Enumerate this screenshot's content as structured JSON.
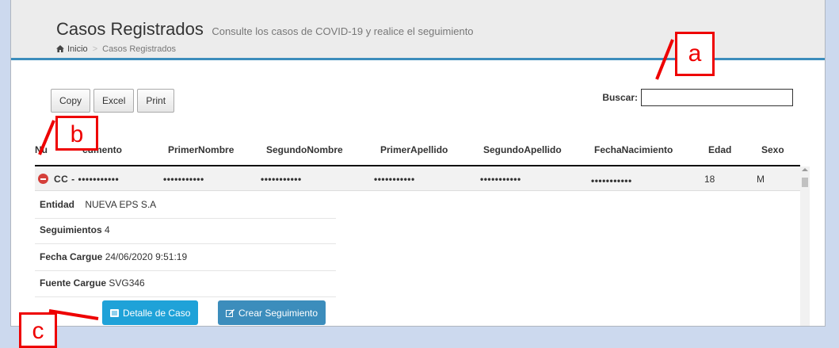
{
  "header": {
    "title": "Casos Registrados",
    "subtitle": "Consulte los casos de COVID-19 y realice el seguimiento",
    "breadcrumb": {
      "home": "Inicio",
      "current": "Casos Registrados"
    }
  },
  "toolbar": {
    "copy_label": "Copy",
    "excel_label": "Excel",
    "print_label": "Print"
  },
  "search": {
    "label": "Buscar:",
    "value": ""
  },
  "table": {
    "columns": [
      "Nu",
      "cumento",
      "PrimerNombre",
      "SegundoNombre",
      "PrimerApellido",
      "SegundoApellido",
      "FechaNacimiento",
      "Edad",
      "Sexo"
    ],
    "row": {
      "documento": "CC - •••••••••••",
      "primer_nombre": "•••••••••••",
      "segundo_nombre": "•••••••••••",
      "primer_apellido": "•••••••••••",
      "segundo_apellido": "•••••••••••",
      "fecha_nacimiento": "•••••••••••",
      "edad": "18",
      "sexo": "M"
    }
  },
  "details": {
    "entidad_label": "Entidad",
    "entidad_value": "NUEVA EPS S.A",
    "seguimientos_label": "Seguimientos",
    "seguimientos_value": "4",
    "fecha_label": "Fecha Cargue",
    "fecha_value": "24/06/2020 9:51:19",
    "fuente_label": "Fuente Cargue",
    "fuente_value": "SVG346"
  },
  "actions": {
    "detalle_label": "Detalle de Caso",
    "crear_label": "Crear Seguimiento"
  },
  "annotations": {
    "a": "a",
    "b": "b",
    "c": "c"
  },
  "colors": {
    "accent": "#3c8dbc",
    "detail_button": "#1fa2d8",
    "annotation": "#e00000",
    "background": "#ccd9ee"
  }
}
